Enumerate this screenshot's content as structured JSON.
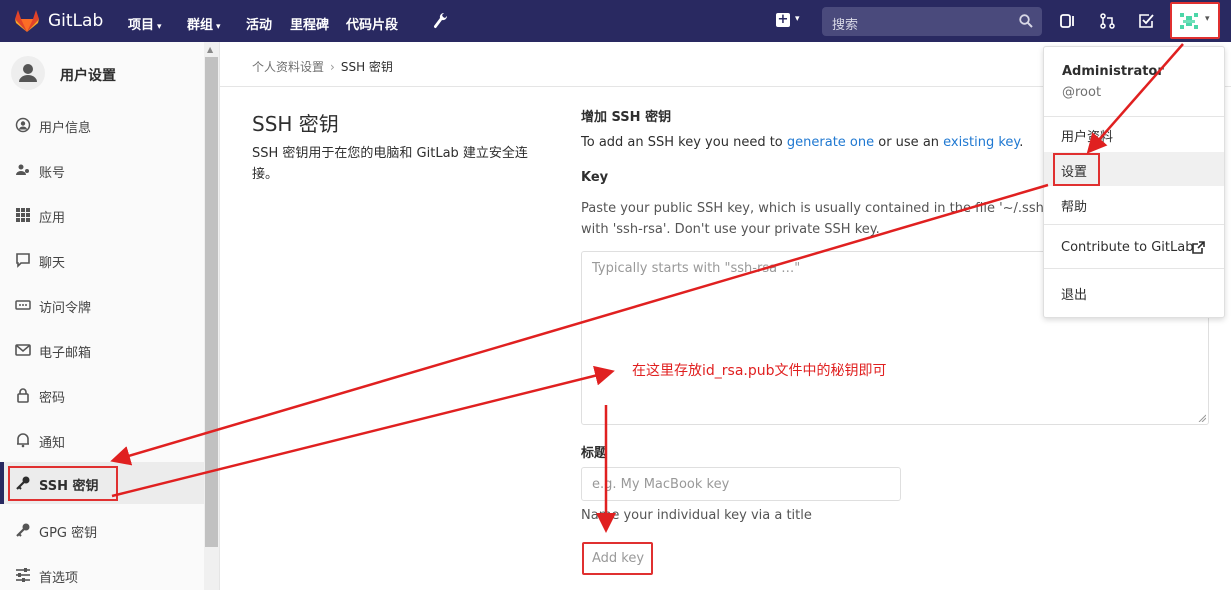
{
  "navbar": {
    "brand": "GitLab",
    "menu": [
      {
        "label": "项目",
        "caret": "▾"
      },
      {
        "label": "群组",
        "caret": "▾"
      },
      {
        "label": "活动",
        "caret": ""
      },
      {
        "label": "里程碑",
        "caret": ""
      },
      {
        "label": "代码片段",
        "caret": ""
      }
    ],
    "search_placeholder": "搜索",
    "plus_symbol": "+",
    "caret": "▾"
  },
  "sidebar": {
    "title": "用户设置",
    "items": [
      {
        "label": "用户信息",
        "icon": "user-circle-icon"
      },
      {
        "label": "账号",
        "icon": "users-icon"
      },
      {
        "label": "应用",
        "icon": "grid-icon"
      },
      {
        "label": "聊天",
        "icon": "chat-icon"
      },
      {
        "label": "访问令牌",
        "icon": "token-icon"
      },
      {
        "label": "电子邮箱",
        "icon": "envelope-icon"
      },
      {
        "label": "密码",
        "icon": "lock-icon"
      },
      {
        "label": "通知",
        "icon": "bell-icon"
      },
      {
        "label": "SSH 密钥",
        "icon": "key-icon"
      },
      {
        "label": "GPG 密钥",
        "icon": "key-icon"
      },
      {
        "label": "首选项",
        "icon": "sliders-icon"
      }
    ]
  },
  "breadcrumb": {
    "parent": "个人资料设置",
    "separator": "›",
    "current": "SSH 密钥"
  },
  "page": {
    "title": "SSH 密钥",
    "description": "SSH 密钥用于在您的电脑和 GitLab 建立安全连接。"
  },
  "form": {
    "section_title": "增加 SSH 密钥",
    "intro_prefix": "To add an SSH key you need to ",
    "intro_link1": "generate one",
    "intro_mid": " or use an ",
    "intro_link2": "existing key",
    "intro_suffix": ".",
    "key_label": "Key",
    "key_help": "Paste your public SSH key, which is usually contained in the file '~/.ssh/id_rsa.pub' and begins with 'ssh-rsa'. Don't use your private SSH key.",
    "key_placeholder": "Typically starts with \"ssh-rsa …\"",
    "title_label": "标题",
    "title_placeholder": "e.g. My MacBook key",
    "title_help": "Name your individual key via a title",
    "submit_label": "Add key"
  },
  "dropdown": {
    "name": "Administrator",
    "username": "@root",
    "items": [
      "用户资料",
      "设置",
      "帮助",
      "Contribute to GitLab",
      "退出"
    ]
  },
  "annotation": {
    "text": "在这里存放id_rsa.pub文件中的秘钥即可"
  },
  "colors": {
    "navbar": "#292961",
    "link": "#1f78d1",
    "annotation": "#e02020"
  }
}
